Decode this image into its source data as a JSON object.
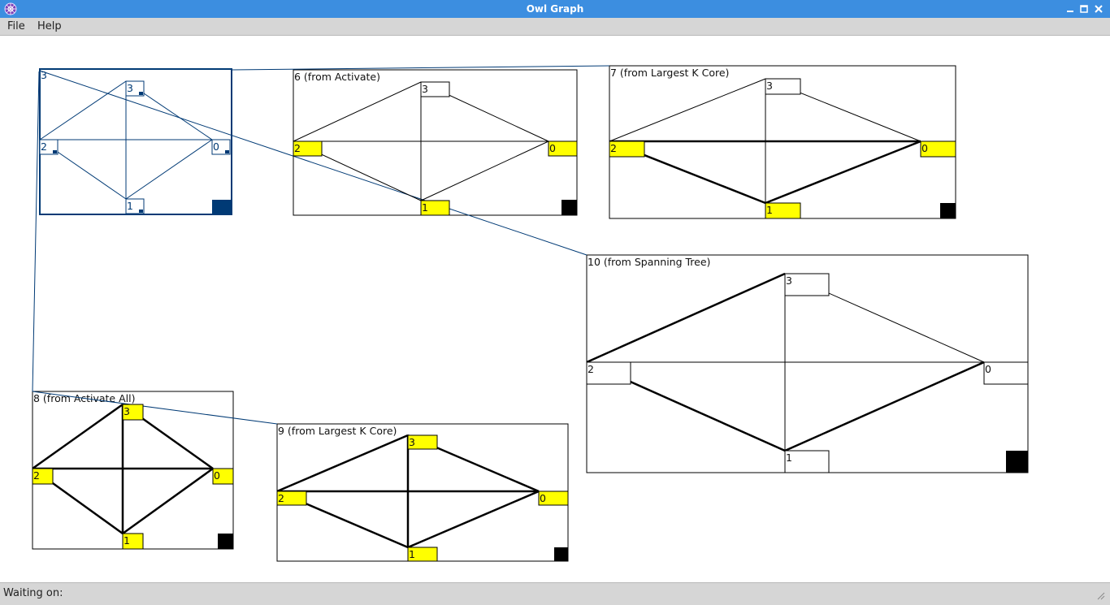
{
  "window": {
    "title": "Owl Graph",
    "title_color": "#3c8ee0"
  },
  "menu": {
    "items": [
      "File",
      "Help"
    ]
  },
  "graphs": [
    {
      "title": "",
      "origin_label": "3",
      "selected": true,
      "nodes": [
        {
          "id": "3",
          "color": "#ffffff"
        },
        {
          "id": "2",
          "color": "#ffffff"
        },
        {
          "id": "0",
          "color": "#ffffff"
        },
        {
          "id": "1",
          "color": "#ffffff"
        }
      ]
    },
    {
      "title": "6 (from Activate)",
      "selected": false,
      "nodes": [
        {
          "id": "3",
          "color": "#ffffff"
        },
        {
          "id": "2",
          "color": "#ffff00"
        },
        {
          "id": "0",
          "color": "#ffff00"
        },
        {
          "id": "1",
          "color": "#ffff00"
        }
      ]
    },
    {
      "title": "7 (from Largest K Core)",
      "selected": false,
      "nodes": [
        {
          "id": "3",
          "color": "#ffffff"
        },
        {
          "id": "2",
          "color": "#ffff00"
        },
        {
          "id": "0",
          "color": "#ffff00"
        },
        {
          "id": "1",
          "color": "#ffff00"
        }
      ]
    },
    {
      "title": "10 (from Spanning Tree)",
      "selected": false,
      "nodes": [
        {
          "id": "3",
          "color": "#ffffff"
        },
        {
          "id": "2",
          "color": "#ffffff"
        },
        {
          "id": "0",
          "color": "#ffffff"
        },
        {
          "id": "1",
          "color": "#ffffff"
        }
      ]
    },
    {
      "title": "8 (from Activate All)",
      "selected": false,
      "nodes": [
        {
          "id": "3",
          "color": "#ffff00"
        },
        {
          "id": "2",
          "color": "#ffff00"
        },
        {
          "id": "0",
          "color": "#ffff00"
        },
        {
          "id": "1",
          "color": "#ffff00"
        }
      ]
    },
    {
      "title": "9 (from Largest K Core)",
      "selected": false,
      "nodes": [
        {
          "id": "3",
          "color": "#ffff00"
        },
        {
          "id": "2",
          "color": "#ffff00"
        },
        {
          "id": "0",
          "color": "#ffff00"
        },
        {
          "id": "1",
          "color": "#ffff00"
        }
      ]
    }
  ],
  "colors": {
    "selection": "#003a75",
    "highlight": "#ffff00",
    "edge": "#000000"
  },
  "status": {
    "text": "Waiting on:"
  }
}
